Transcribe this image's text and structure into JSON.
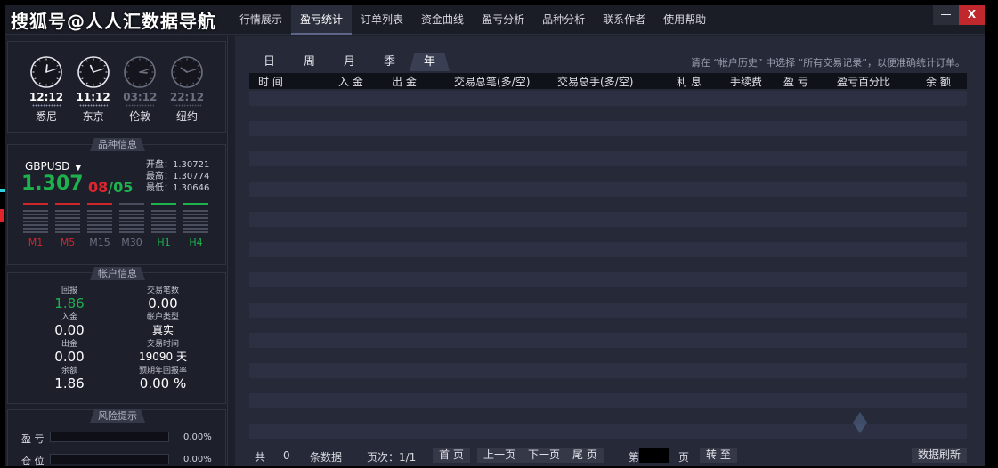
{
  "watermark": "搜狐号@人人汇数据导航",
  "tabs": [
    {
      "label": "行情展示"
    },
    {
      "label": "盈亏统计"
    },
    {
      "label": "订单列表"
    },
    {
      "label": "资金曲线"
    },
    {
      "label": "盈亏分析"
    },
    {
      "label": "品种分析"
    },
    {
      "label": "联系作者"
    },
    {
      "label": "使用帮助"
    }
  ],
  "window": {
    "minimize": "—",
    "close": "X"
  },
  "clocks": [
    {
      "time": "12:12",
      "city": "悉尼",
      "active": true,
      "hour": 12,
      "minute": 12
    },
    {
      "time": "11:12",
      "city": "东京",
      "active": true,
      "hour": 11,
      "minute": 12
    },
    {
      "time": "03:12",
      "city": "伦敦",
      "active": false,
      "hour": 3,
      "minute": 12
    },
    {
      "time": "22:12",
      "city": "纽约",
      "active": false,
      "hour": 22,
      "minute": 12
    }
  ],
  "symbol_section": {
    "title": "品种信息",
    "symbol": "GBPUSD",
    "price_main": "1.307",
    "price_pip1": "08",
    "price_slash": "/",
    "price_pip2": "05",
    "open": "开盘：1.30721",
    "high": "最高：1.30774",
    "low": "最低：1.30646",
    "timeframes": [
      {
        "label": "M1",
        "color": "#d0262c"
      },
      {
        "label": "M5",
        "color": "#d0262c"
      },
      {
        "label": "M15",
        "color": "#6b6f80"
      },
      {
        "label": "M30",
        "color": "#6b6f80"
      },
      {
        "label": "H1",
        "color": "#1eb24f"
      },
      {
        "label": "H4",
        "color": "#1eb24f"
      }
    ]
  },
  "account_section": {
    "title": "帐户信息",
    "items": [
      {
        "label": "回报",
        "value": "1.86"
      },
      {
        "label": "交易笔数",
        "value": "0.00"
      },
      {
        "label": "入金",
        "value": "0.00"
      },
      {
        "label": "帐户类型",
        "value": "真实"
      },
      {
        "label": "出金",
        "value": "0.00"
      },
      {
        "label": "交易时间",
        "value": "19090 天"
      },
      {
        "label": "余额",
        "value": "1.86"
      },
      {
        "label": "预期年回报率",
        "value": "0.00 %"
      }
    ]
  },
  "risk_section": {
    "title": "风险提示",
    "profit_label": "盈 亏",
    "profit_value": "0.00%",
    "position_label": "仓 位",
    "position_value": "0.00%"
  },
  "period_tabs": [
    "日",
    "周",
    "月",
    "季",
    "年"
  ],
  "hint": "请在 “帐户历史” 中选择 “所有交易记录”，以便准确统计订单。",
  "columns": [
    "时 间",
    "入 金",
    "出 金",
    "交易总笔(多/空)",
    "交易总手(多/空)",
    "利 息",
    "手续费",
    "盈 亏",
    "盈亏百分比",
    "余 额"
  ],
  "footer": {
    "total_label": "共",
    "total_count": "0",
    "records_label": "条数据",
    "page_label": "页次：1/1",
    "first": "首 页",
    "prev": "上一页",
    "next": "下一页",
    "last": "尾 页",
    "goto_prefix": "第",
    "goto_suffix": "页",
    "goto": "转 至",
    "refresh": "数据刷新"
  }
}
